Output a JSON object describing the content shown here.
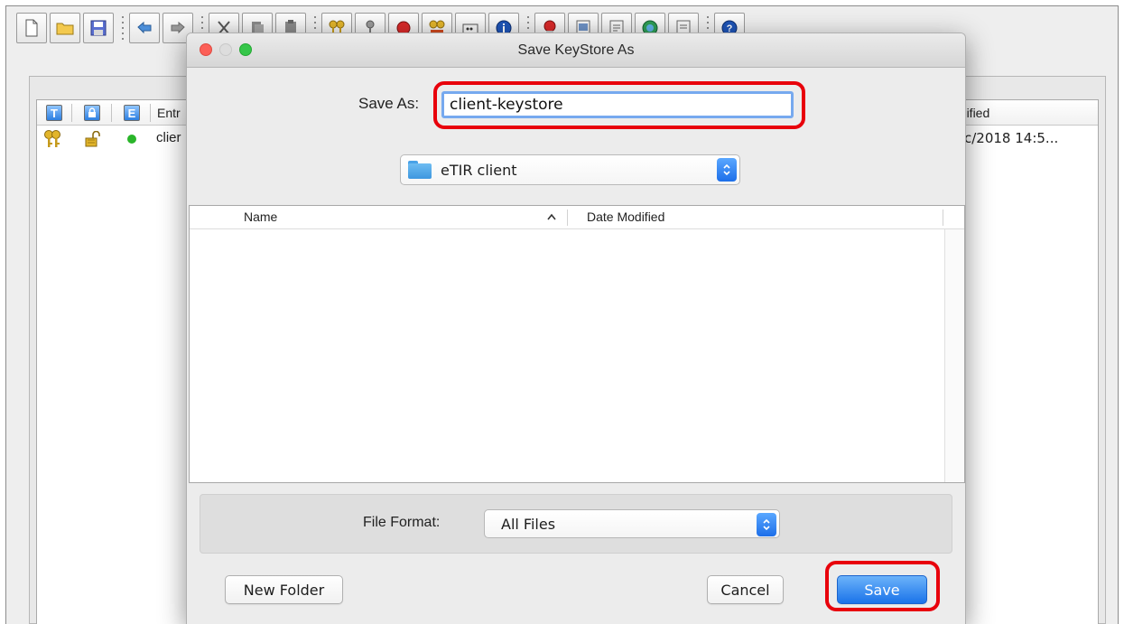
{
  "app": {
    "toolbar_icons": [
      "new-document-icon",
      "open-folder-icon",
      "save-disk-icon",
      "undo-icon",
      "redo-icon",
      "cut-icon",
      "copy-icon",
      "paste-icon",
      "generate-keypair-icon",
      "generate-secret-key-icon",
      "import-trusted-cert-icon",
      "import-keypair-icon",
      "set-password-icon",
      "keystore-properties-icon",
      "examine-certificate-icon",
      "examine-crl-icon",
      "examine-ssl-icon",
      "examine-csr-icon",
      "help-icon"
    ],
    "columns": [
      "T",
      "E",
      "Entr",
      "odified"
    ],
    "row": {
      "entry_partial": "clier",
      "modified_partial": "c/2018 14:5..."
    }
  },
  "dialog": {
    "title": "Save KeyStore As",
    "save_as_label": "Save As:",
    "save_as_value": "client-keystore",
    "folder": "eTIR client",
    "file_list": {
      "name_header": "Name",
      "date_header": "Date Modified"
    },
    "format_label": "File Format:",
    "format_value": "All Files",
    "new_folder": "New Folder",
    "cancel": "Cancel",
    "save": "Save"
  },
  "colors": {
    "highlight": "#e8000b",
    "primary_button": "#1a73e9",
    "folder_blue": "#48a2e8"
  }
}
